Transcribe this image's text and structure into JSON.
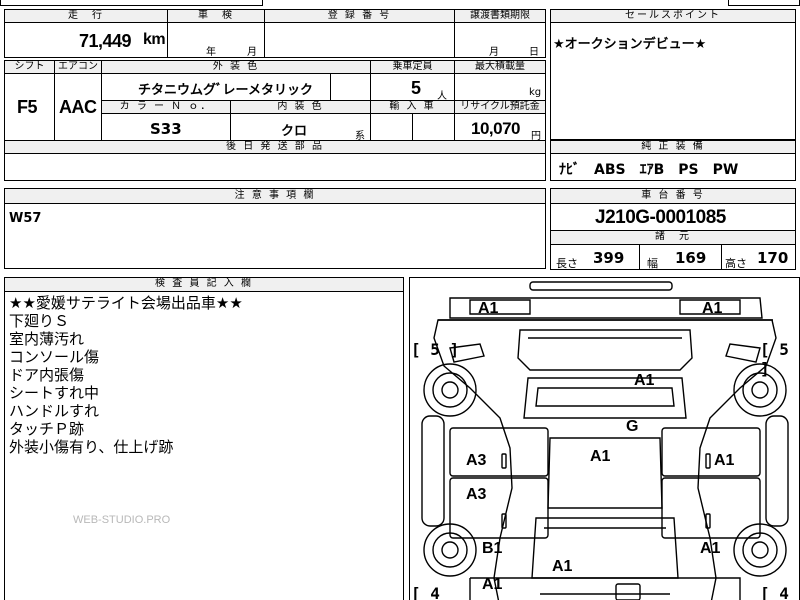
{
  "top": {
    "mileage_header": "走　行",
    "mileage_value": "71,449",
    "mileage_unit": "km",
    "inspection_header": "車　検",
    "inspection_year": "年",
    "inspection_month": "月",
    "reg_header": "登 録 番 号",
    "transfer_header": "譲渡書類期限",
    "transfer_month": "月",
    "transfer_day": "日",
    "sales_header": "セールスポイント",
    "sales_text": "★オークションデビュー★"
  },
  "spec": {
    "shift_header": "シフト",
    "shift_value": "F5",
    "aircon_header": "エアコン",
    "aircon_value": "AAC",
    "exterior_header": "外 装 色",
    "exterior_value": "チタニウムグﾞレーメタリック",
    "capacity_header": "乗車定員",
    "capacity_value": "5",
    "capacity_unit": "人",
    "load_header": "最大積載量",
    "load_unit": "kg",
    "color_no_header": "カ ラ ー Ｎ ｏ．",
    "color_no_value": "S33",
    "interior_header": "内 装 色",
    "interior_value": "クロ",
    "interior_suffix": "系",
    "import_header": "輸 入 車",
    "recycle_header": "リサイクル預託金",
    "recycle_value": "10,070",
    "recycle_unit": "円",
    "parts_header": "後 日 発 送 部 品"
  },
  "equipment": {
    "header": "純 正 装 備",
    "value": "ﾅﾋﾞ　ABS　ｴｱB　PS　PW"
  },
  "notes": {
    "header": "注 意 事 項 欄",
    "value": "W57"
  },
  "chassis": {
    "header": "車 台 番 号",
    "value": "J210G-0001085",
    "dims_header": "諸　元",
    "length_label": "長さ",
    "length_value": "399",
    "width_label": "幅",
    "width_value": "169",
    "height_label": "高さ",
    "height_value": "170"
  },
  "inspector": {
    "header": "検 査 員 記 入 欄",
    "lines": [
      "★★愛媛サテライト会場出品車★★",
      "下廻りＳ",
      "室内薄汚れ",
      "コンソール傷",
      "ドア内張傷",
      "シートすれ中",
      "ハンドルすれ",
      "タッチＰ跡",
      "外装小傷有り、仕上げ跡"
    ],
    "watermark": "WEB-STUDIO.PRO"
  },
  "diagram": {
    "marks": [
      "A1",
      "A1",
      "A1",
      "G",
      "A1",
      "A3",
      "A1",
      "A3",
      "B1",
      "A1",
      "A1",
      "A1"
    ],
    "tires": [
      "[ 5 ]",
      "[ 5 ]",
      "[ 4",
      "[ 4"
    ]
  }
}
